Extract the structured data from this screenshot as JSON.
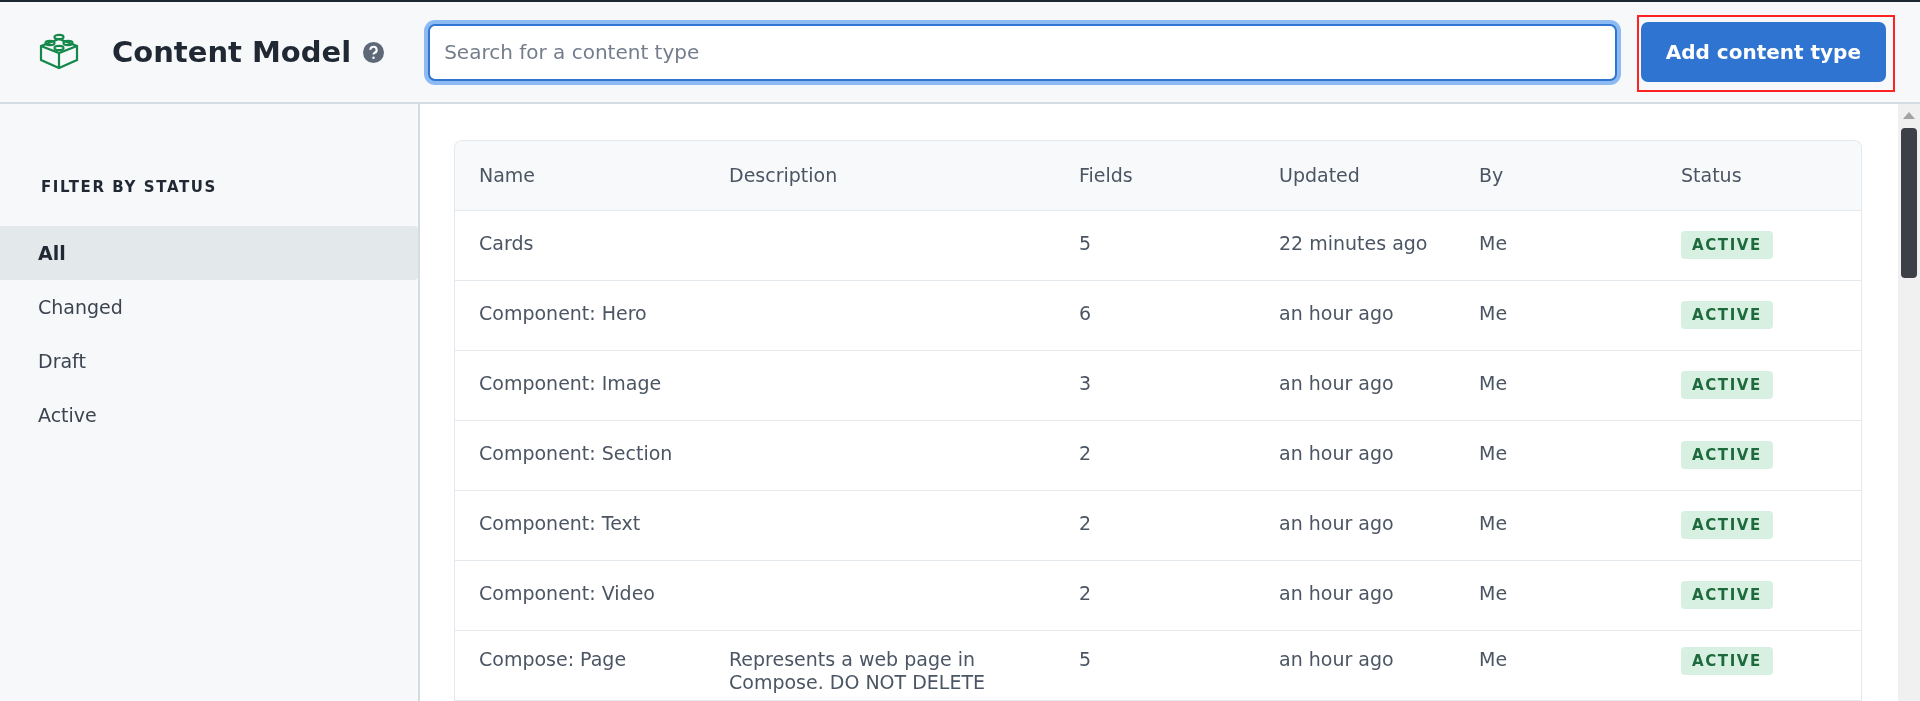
{
  "header": {
    "title": "Content Model",
    "search": {
      "placeholder": "Search for a content type"
    },
    "add_button": {
      "label": "Add content type",
      "highlighted": true
    }
  },
  "sidebar": {
    "heading": "FILTER BY STATUS",
    "items": [
      {
        "label": "All",
        "selected": true
      },
      {
        "label": "Changed",
        "selected": false
      },
      {
        "label": "Draft",
        "selected": false
      },
      {
        "label": "Active",
        "selected": false
      }
    ]
  },
  "table": {
    "columns": [
      "Name",
      "Description",
      "Fields",
      "Updated",
      "By",
      "Status"
    ],
    "rows": [
      {
        "name": "Cards",
        "description": "",
        "fields": "5",
        "updated": "22 minutes ago",
        "by": "Me",
        "status": "ACTIVE"
      },
      {
        "name": "Component: Hero",
        "description": "",
        "fields": "6",
        "updated": "an hour ago",
        "by": "Me",
        "status": "ACTIVE"
      },
      {
        "name": "Component: Image",
        "description": "",
        "fields": "3",
        "updated": "an hour ago",
        "by": "Me",
        "status": "ACTIVE"
      },
      {
        "name": "Component: Section",
        "description": "",
        "fields": "2",
        "updated": "an hour ago",
        "by": "Me",
        "status": "ACTIVE"
      },
      {
        "name": "Component: Text",
        "description": "",
        "fields": "2",
        "updated": "an hour ago",
        "by": "Me",
        "status": "ACTIVE"
      },
      {
        "name": "Component: Video",
        "description": "",
        "fields": "2",
        "updated": "an hour ago",
        "by": "Me",
        "status": "ACTIVE"
      },
      {
        "name": "Compose: Page",
        "description": "Represents a web page in Compose. DO NOT DELETE",
        "fields": "5",
        "updated": "an hour ago",
        "by": "Me",
        "status": "ACTIVE"
      }
    ]
  }
}
